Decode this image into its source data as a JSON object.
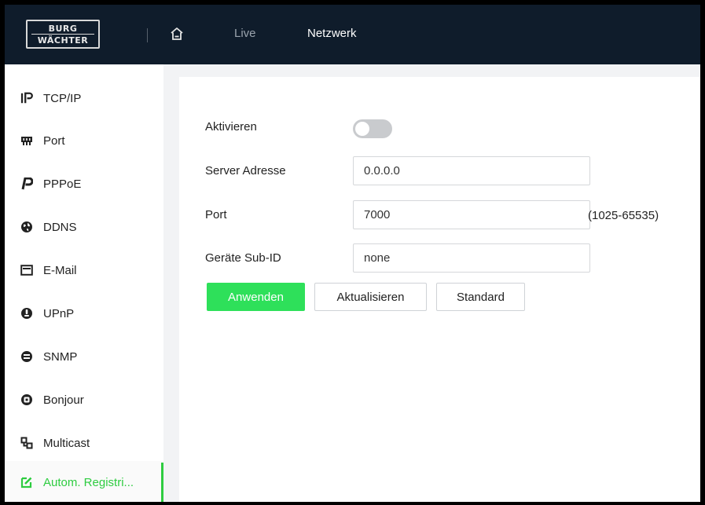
{
  "header": {
    "logo_line1": "BURG",
    "logo_line2": "WÄCHTER",
    "nav_live": "Live",
    "nav_network": "Netzwerk",
    "home_icon": "home-icon"
  },
  "sidebar": {
    "items": [
      {
        "label": "TCP/IP",
        "icon": "ip-icon"
      },
      {
        "label": "Port",
        "icon": "port-icon"
      },
      {
        "label": "PPPoE",
        "icon": "pppoe-icon"
      },
      {
        "label": "DDNS",
        "icon": "globe-icon"
      },
      {
        "label": "E-Mail",
        "icon": "mail-icon"
      },
      {
        "label": "UPnP",
        "icon": "upnp-icon"
      },
      {
        "label": "SNMP",
        "icon": "snmp-icon"
      },
      {
        "label": "Bonjour",
        "icon": "bonjour-icon"
      },
      {
        "label": "Multicast",
        "icon": "multicast-icon"
      },
      {
        "label": "Autom. Registri...",
        "icon": "edit-icon",
        "active": true
      }
    ]
  },
  "form": {
    "enable_label": "Aktivieren",
    "enable_value": false,
    "server_label": "Server Adresse",
    "server_value": "0.0.0.0",
    "port_label": "Port",
    "port_value": "7000",
    "port_range": "(1025-65535)",
    "subid_label": "Geräte Sub-ID",
    "subid_value": "none"
  },
  "buttons": {
    "apply": "Anwenden",
    "refresh": "Aktualisieren",
    "default": "Standard"
  },
  "colors": {
    "topbar": "#0f1c2b",
    "accent_green": "#2ecc40",
    "apply_green": "#2ee05a"
  }
}
